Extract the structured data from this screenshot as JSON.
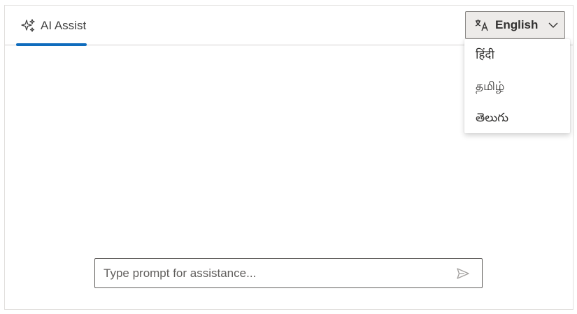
{
  "header": {
    "tab_label": "AI Assist",
    "tab_icon": "sparkle-icon",
    "accent_color": "#0f6cbd"
  },
  "language": {
    "selected": "English",
    "icon": "translate-icon",
    "options": [
      "हिंदी",
      "தமிழ்",
      "తెలుగు"
    ]
  },
  "prompt": {
    "placeholder": "Type prompt for assistance...",
    "value": "",
    "send_icon": "send-icon"
  }
}
